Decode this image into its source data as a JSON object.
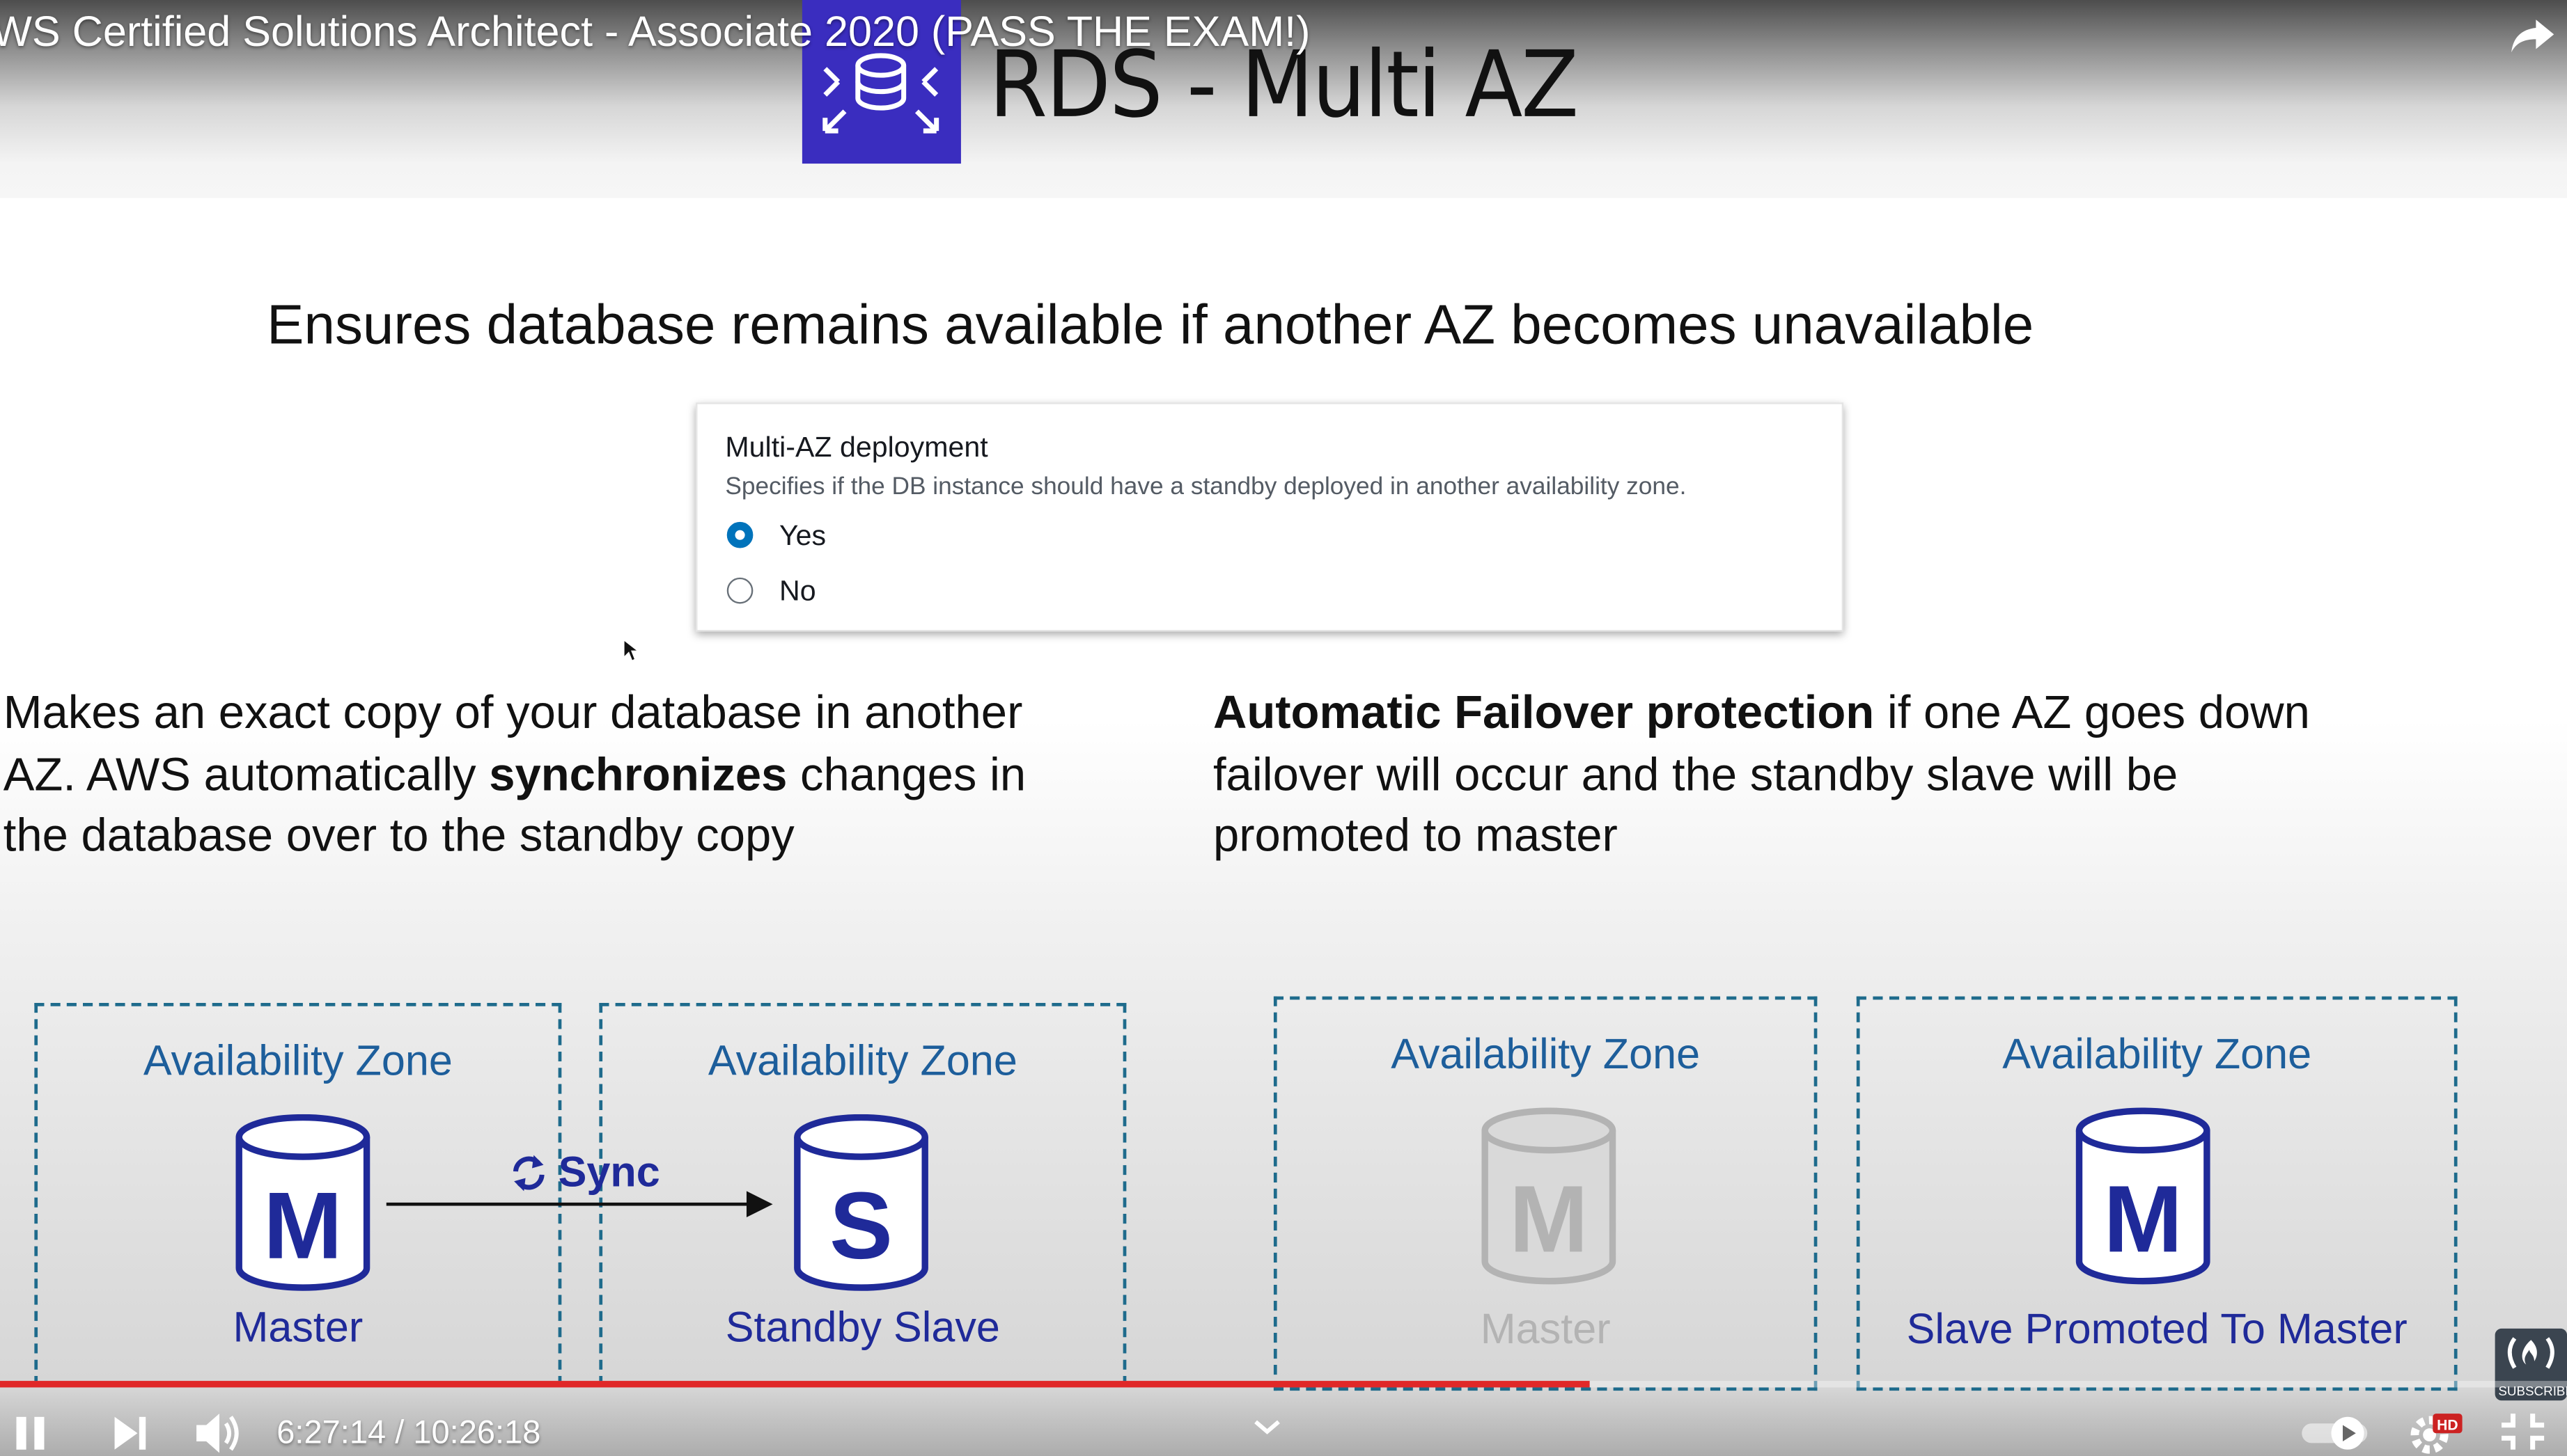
{
  "player": {
    "video_title": "WS Certified Solutions Architect - Associate 2020 (PASS THE EXAM!)",
    "time_current": "6:27:14",
    "time_separator": " / ",
    "time_total": "10:26:18",
    "progress_fraction": 0.6195,
    "quality_badge": "HD",
    "subscribe_label": "SUBSCRIBE",
    "accent_color": "#e02828"
  },
  "slide": {
    "title": "RDS - Multi AZ",
    "subtitle": "Ensures database remains available if another AZ becomes unavailable",
    "console_panel": {
      "heading": "Multi-AZ deployment",
      "description": "Specifies if the DB instance should have a standby deployed in another availability zone.",
      "options": [
        {
          "label": "Yes",
          "selected": true
        },
        {
          "label": "No",
          "selected": false
        }
      ]
    },
    "left_paragraph": {
      "line1": "Makes an exact copy of your database in another",
      "line2_pre": "AZ. AWS automatically ",
      "line2_bold": "synchronizes",
      "line2_post": " changes in",
      "line3": "the database over to the standby copy"
    },
    "right_paragraph": {
      "line1_bold": "Automatic Failover protection",
      "line1_post": " if one AZ goes down",
      "line2": "failover will occur and the standby slave will be",
      "line3": "promoted to master"
    },
    "zones": [
      {
        "title": "Availability Zone",
        "db_letter": "M",
        "caption": "Master",
        "state": "active"
      },
      {
        "title": "Availability Zone",
        "db_letter": "S",
        "caption": "Standby Slave",
        "state": "active"
      },
      {
        "title": "Availability Zone",
        "db_letter": "M",
        "caption": "Master",
        "state": "failed"
      },
      {
        "title": "Availability Zone",
        "db_letter": "M",
        "caption": "Slave Promoted To Master",
        "state": "active"
      }
    ],
    "sync_label": "Sync",
    "colors": {
      "db_active": "#1f2a99",
      "db_failed": "#b3b3b3",
      "zone_border": "#1e6b8c",
      "zone_title": "#1d5e9b",
      "radio_selected": "#0073bb",
      "logo_bg": "#3a2dbf"
    }
  }
}
